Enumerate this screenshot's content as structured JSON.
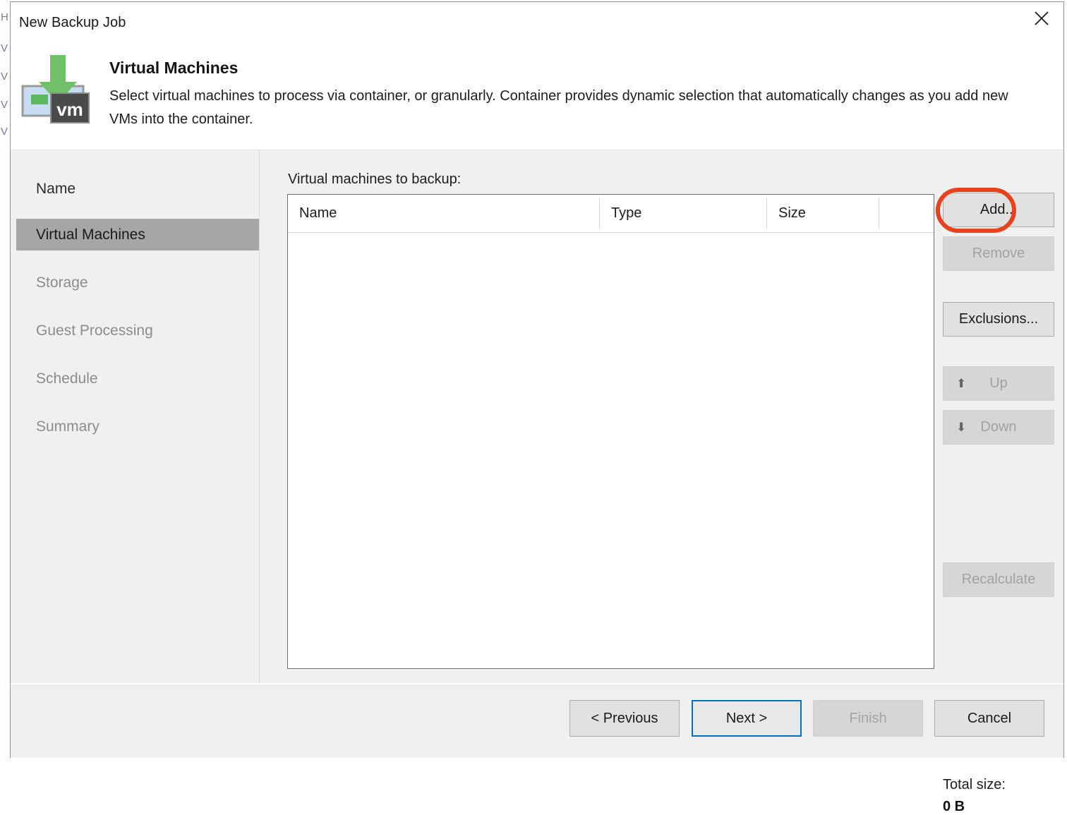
{
  "window": {
    "title": "New Backup Job",
    "close_icon": "close-icon"
  },
  "header": {
    "icon": "vm-backup-icon",
    "title": "Virtual Machines",
    "description": "Select virtual machines to process via container, or granularly. Container provides dynamic selection that automatically changes as you add new VMs into the container."
  },
  "sidebar": {
    "items": [
      {
        "label": "Name",
        "state": "done"
      },
      {
        "label": "Virtual Machines",
        "state": "active"
      },
      {
        "label": "Storage",
        "state": "pending"
      },
      {
        "label": "Guest Processing",
        "state": "pending"
      },
      {
        "label": "Schedule",
        "state": "pending"
      },
      {
        "label": "Summary",
        "state": "pending"
      }
    ]
  },
  "main": {
    "list_label": "Virtual machines to backup:",
    "table": {
      "columns": [
        "Name",
        "Type",
        "Size",
        ""
      ],
      "rows": []
    },
    "side_buttons": [
      {
        "label": "Add...",
        "name": "add-button",
        "enabled": true,
        "icon": ""
      },
      {
        "label": "Remove",
        "name": "remove-button",
        "enabled": false,
        "icon": ""
      },
      {
        "label": "Exclusions...",
        "name": "exclusions-button",
        "enabled": true,
        "icon": ""
      },
      {
        "label": "Up",
        "name": "move-up-button",
        "enabled": false,
        "icon": "⬆"
      },
      {
        "label": "Down",
        "name": "move-down-button",
        "enabled": false,
        "icon": "⬇"
      },
      {
        "label": "Recalculate",
        "name": "recalculate-button",
        "enabled": false,
        "icon": ""
      }
    ],
    "total_size_label": "Total size:",
    "total_size_value": "0 B"
  },
  "footer": {
    "previous": "< Previous",
    "next": "Next >",
    "finish": "Finish",
    "cancel": "Cancel"
  },
  "colors": {
    "annotation": "#e8411c",
    "selection": "#a6a6a6",
    "primary_focus": "#0072c6",
    "body": "#f0f0f0"
  },
  "backdrop": {
    "ghost_lines": [
      "M",
      "M",
      "M",
      "M",
      "M"
    ]
  }
}
